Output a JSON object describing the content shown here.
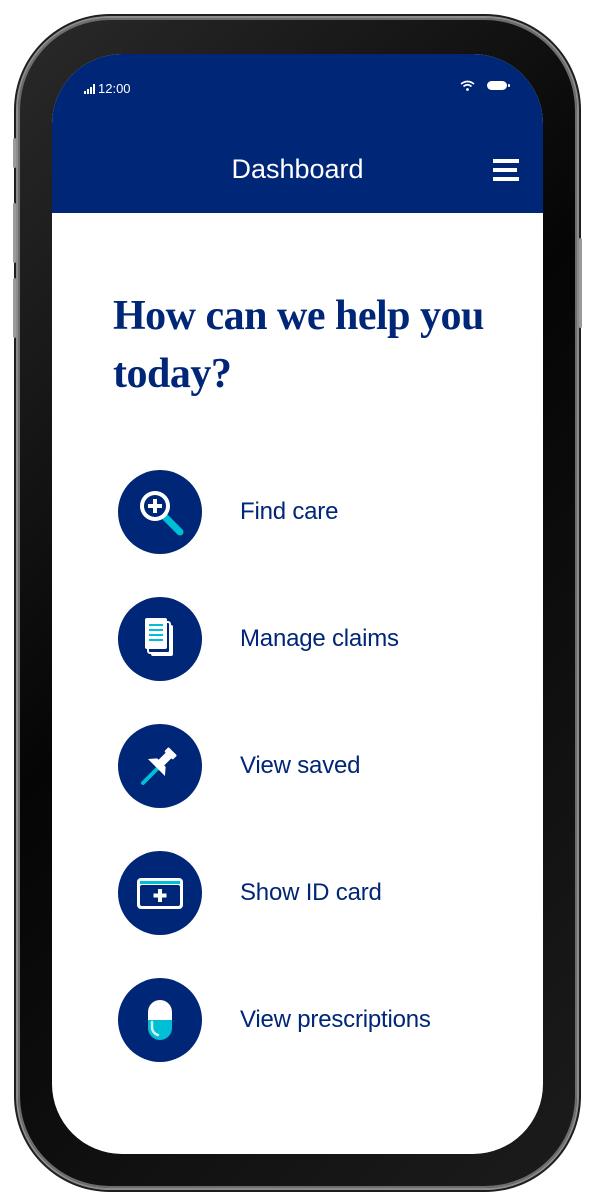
{
  "status_bar": {
    "time": "12:00",
    "icons": [
      "signal-icon",
      "wifi-icon",
      "battery-icon"
    ]
  },
  "header": {
    "title": "Dashboard",
    "menu_icon": "hamburger-menu-icon"
  },
  "main": {
    "headline": "How can we help you today?",
    "actions": [
      {
        "label": "Find care",
        "icon": "magnifier-plus-icon"
      },
      {
        "label": "Manage claims",
        "icon": "document-stack-icon"
      },
      {
        "label": "View saved",
        "icon": "pushpin-icon"
      },
      {
        "label": "Show ID card",
        "icon": "id-card-icon"
      },
      {
        "label": "View prescriptions",
        "icon": "pill-capsule-icon"
      }
    ]
  },
  "colors": {
    "brand": "#002677",
    "accent": "#00bed5",
    "light_accent": "#d3eef5",
    "background": "#ffffff"
  }
}
